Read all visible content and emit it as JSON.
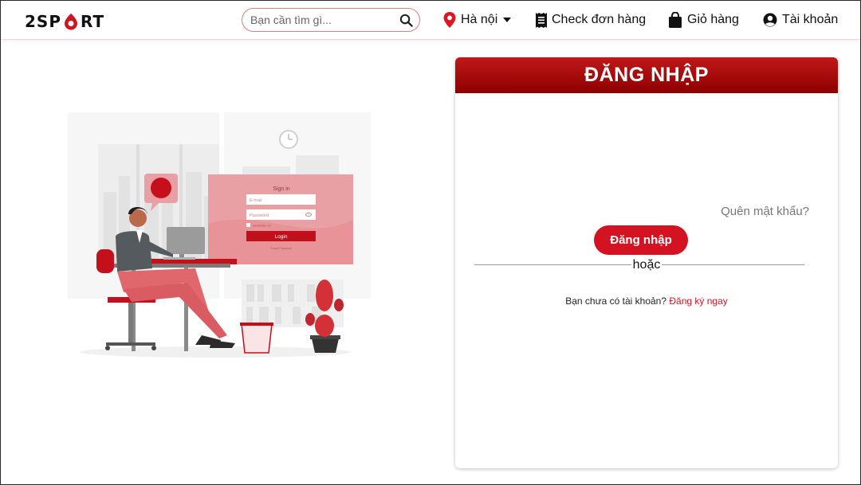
{
  "header": {
    "logo": {
      "text_left": "2SP",
      "text_right": "RT"
    },
    "search": {
      "placeholder": "Bạn cần tìm gì..."
    },
    "location": {
      "label": "Hà nội"
    },
    "check_order": {
      "label": "Check đơn hàng"
    },
    "cart": {
      "label": "Giỏ hàng"
    },
    "account": {
      "label": "Tài khoản"
    }
  },
  "illustration": {
    "form_title": "Sign in",
    "email_placeholder": "E-mail",
    "password_placeholder": "Password",
    "remember_label": "Remember me",
    "login_button": "Login",
    "forgot_link": "Forgot Password"
  },
  "login_card": {
    "title": "ĐĂNG NHẬP",
    "forgot_password": "Quên mật khẩu?",
    "login_button": "Đăng nhập",
    "or_text": "hoặc",
    "no_account_text": "Bạn chưa có tài khoản?",
    "register_link": "Đăng ký ngay"
  },
  "colors": {
    "brand_red": "#d41322",
    "header_gradient_top": "#c01818",
    "header_gradient_bottom": "#8e0000",
    "illustration_pink": "#e8a0a4"
  },
  "icons": [
    "map-pin-icon",
    "chevron-down-icon",
    "receipt-icon",
    "shopping-bag-icon",
    "user-circle-icon",
    "search-icon"
  ]
}
